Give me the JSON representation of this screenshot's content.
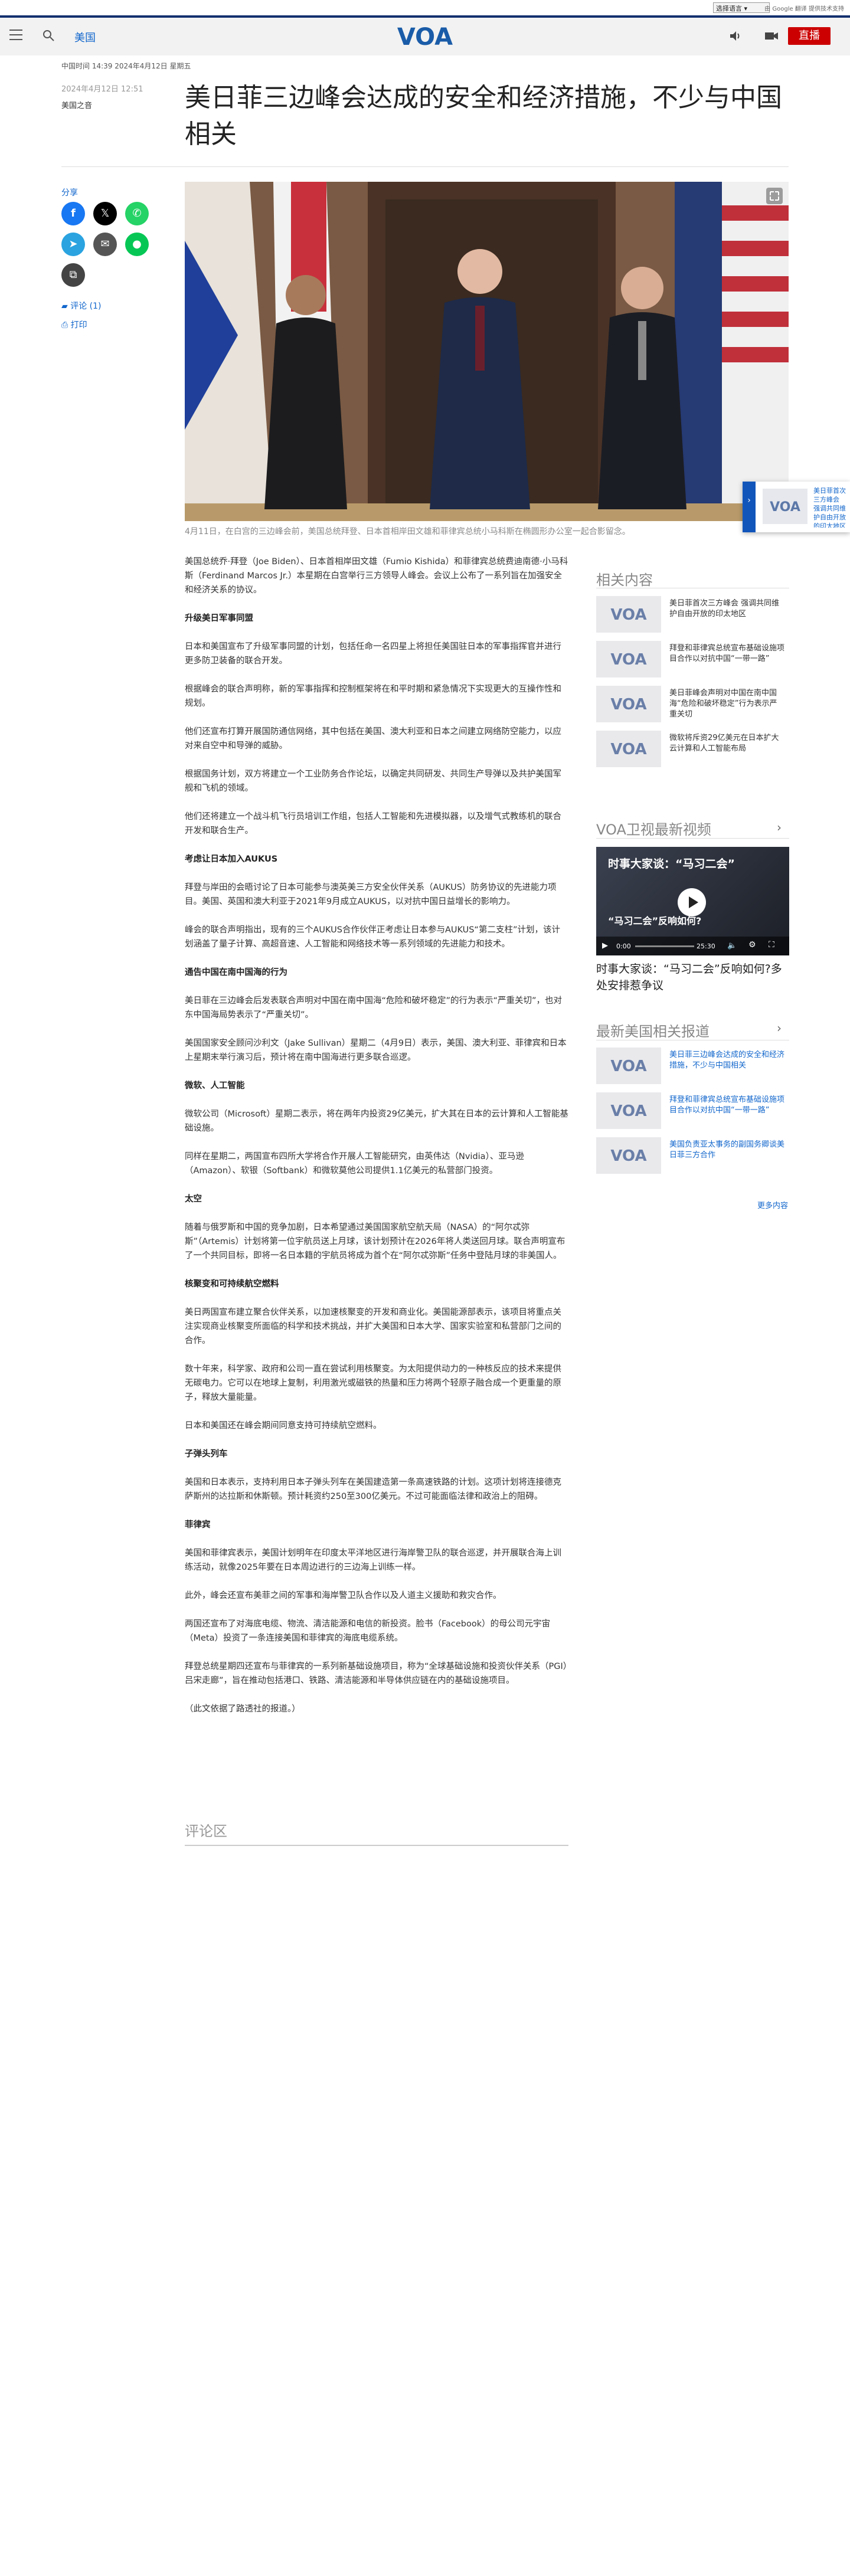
{
  "translate": {
    "select_label": "选择语言",
    "by_text": "由 Google 翻译 提供技术支持"
  },
  "header": {
    "nav_label": "美国",
    "live_label": "直播"
  },
  "article": {
    "dateline": "中国时间 14:39 2024年4月12日 星期五",
    "pub_date": "2024年4月12日 12:51",
    "byline": "美国之音",
    "title": "美日菲三边峰会达成的安全和经济措施，不少与中国相关",
    "share_label": "分享",
    "comments_link": "评论 (1)",
    "print_link": "打印",
    "caption": "4月11日，在白宫的三边峰会前，美国总统拜登、日本首相岸田文雄和菲律宾总统小马科斯在椭圆形办公室一起合影留念。",
    "paragraphs": [
      {
        "type": "p",
        "text": "美国总统乔·拜登（Joe Biden）、日本首相岸田文雄（Fumio Kishida）和菲律宾总统费迪南德·小马科斯（Ferdinand Marcos Jr.）本星期在白宫举行三方领导人峰会。会议上公布了一系列旨在加强安全和经济关系的协议。"
      },
      {
        "type": "h",
        "text": "升级美日军事同盟"
      },
      {
        "type": "p",
        "text": "日本和美国宣布了升级军事同盟的计划，包括任命一名四星上将担任美国驻日本的军事指挥官并进行更多防卫装备的联合开发。"
      },
      {
        "type": "p",
        "text": "根据峰会的联合声明称，新的军事指挥和控制框架将在和平时期和紧急情况下实现更大的互操作性和规划。"
      },
      {
        "type": "p",
        "text": "他们还宣布打算开展国防通信网络，其中包括在美国、澳大利亚和日本之间建立网络防空能力，以应对来自空中和导弹的威胁。"
      },
      {
        "type": "p",
        "text": "根据国务计划，双方将建立一个工业防务合作论坛，以确定共同研发、共同生产导弹以及共护美国军舰和飞机的领域。"
      },
      {
        "type": "p",
        "text": "他们还将建立一个战斗机飞行员培训工作组，包括人工智能和先进模拟器，以及增气式教练机的联合开发和联合生产。"
      },
      {
        "type": "h",
        "text": "考虑让日本加入AUKUS"
      },
      {
        "type": "p",
        "text": "拜登与岸田的会晤讨论了日本可能参与澳英美三方安全伙伴关系（AUKUS）防务协议的先进能力项目。美国、英国和澳大利亚于2021年9月成立AUKUS，以对抗中国日益增长的影响力。"
      },
      {
        "type": "p",
        "text": "峰会的联合声明指出，现有的三个AUKUS合作伙伴正考虑让日本参与AUKUS“第二支柱”计划，该计划涵盖了量子计算、高超音速、人工智能和网络技术等一系列领域的先进能力和技术。"
      },
      {
        "type": "h",
        "text": "通告中国在南中国海的行为"
      },
      {
        "type": "p",
        "text": "美日菲在三边峰会后发表联合声明对中国在南中国海“危险和破坏稳定”的行为表示“严重关切”，也对东中国海局势表示了“严重关切”。"
      },
      {
        "type": "p",
        "text": "美国国家安全顾问沙利文（Jake Sullivan）星期二（4月9日）表示，美国、澳大利亚、菲律宾和日本上星期末举行演习后，预计将在南中国海进行更多联合巡逻。"
      },
      {
        "type": "h",
        "text": "微软、人工智能"
      },
      {
        "type": "p",
        "text": "微软公司（Microsoft）星期二表示，将在两年内投资29亿美元，扩大其在日本的云计算和人工智能基础设施。"
      },
      {
        "type": "p",
        "text": "同样在星期二，两国宣布四所大学将合作开展人工智能研究，由英伟达（Nvidia）、亚马逊（Amazon）、软银（Softbank）和微软莫他公司提供1.1亿美元的私营部门投资。"
      },
      {
        "type": "h",
        "text": "太空"
      },
      {
        "type": "p",
        "text": "随着与俄罗斯和中国的竞争加剧，日本希望通过美国国家航空航天局（NASA）的“阿尔忒弥斯”（Artemis）计划将第一位宇航员送上月球，该计划预计在2026年将人类送回月球。联合声明宣布了一个共同目标，即将一名日本籍的宇航员将成为首个在“阿尔忒弥斯”任务中登陆月球的非美国人。"
      },
      {
        "type": "h",
        "text": "核聚变和可持续航空燃料"
      },
      {
        "type": "p",
        "text": "美日两国宣布建立聚合伙伴关系，以加速核聚变的开发和商业化。美国能源部表示，该项目将重点关注实现商业核聚变所面临的科学和技术挑战，并扩大美国和日本大学、国家实验室和私营部门之间的合作。"
      },
      {
        "type": "p",
        "text": "数十年来，科学家、政府和公司一直在尝试利用核聚变。为太阳提供动力的一种核反应的技术来提供无碳电力。它可以在地球上复制，利用激光或磁铁的热量和压力将两个轻原子融合成一个更重量的原子，释放大量能量。"
      },
      {
        "type": "p",
        "text": "日本和美国还在峰会期间同意支持可持续航空燃料。"
      },
      {
        "type": "h",
        "text": "子弹头列车"
      },
      {
        "type": "p",
        "text": "美国和日本表示，支持利用日本子弹头列车在美国建造第一条高速铁路的计划。这项计划将连接德克萨斯州的达拉斯和休斯顿。预计耗资约250至300亿美元。不过可能面临法律和政治上的阻碍。"
      },
      {
        "type": "h",
        "text": "菲律宾"
      },
      {
        "type": "p",
        "text": "美国和菲律宾表示，美国计划明年在印度太平洋地区进行海岸警卫队的联合巡逻，并开展联合海上训练活动，就像2025年要在日本周边进行的三边海上训练一样。"
      },
      {
        "type": "p",
        "text": "此外，峰会还宣布美菲之间的军事和海岸警卫队合作以及人道主义援助和救灾合作。"
      },
      {
        "type": "p",
        "text": "两国还宣布了对海底电缆、物流、清洁能源和电信的新投资。脸书（Facebook）的母公司元宇宙（Meta）投资了一条连接美国和菲律宾的海底电缆系统。"
      },
      {
        "type": "p",
        "text": "拜登总统星期四还宣布与菲律宾的一系列新基础设施项目，称为“全球基础设施和投资伙伴关系（PGI）吕宋走廊”，旨在推动包括港口、铁路、清洁能源和半导体供应链在内的基础设施项目。"
      },
      {
        "type": "p",
        "text": "（此文依据了路透社的报道。）"
      }
    ],
    "comments_heading": "评论区"
  },
  "sidebar": {
    "related_heading": "相关内容",
    "related": [
      "美日菲首次三方峰会 强调共同维护自由开放的印太地区",
      "拜登和菲律宾总统宣布基础设施项目合作以对抗中国“一带一路”",
      "美日菲峰会声明对中国在南中国海“危险和破坏稳定”行为表示严重关切",
      "微软将斥资29亿美元在日本扩大云计算和人工智能布局"
    ],
    "video_heading": "VOA卫视最新视频",
    "video_overlay_1": "时事大家谈：“马习二会”",
    "video_overlay_2": "“马习二会”反响如何?",
    "video_time_current": "0:00",
    "video_time_total": "25:30",
    "video_title": "时事大家谈：“马习二会”反响如何?多处安排惹争议",
    "latest_heading": "最新美国相关报道",
    "latest": [
      "美日菲三边峰会达成的安全和经济措施，不少与中国相关",
      "拜登和菲律宾总统宣布基础设施项目合作以对抗中国“一带一路”",
      "美国负责亚太事务的副国务卿谈美日菲三方合作"
    ],
    "more_link": "更多内容"
  },
  "floater": {
    "text": "美日菲首次三方峰会 强调共同维护自由开放的印太地区"
  },
  "colors": {
    "brand_blue": "#13306e",
    "link_blue": "#1166cc",
    "live_red": "#cc0000"
  }
}
